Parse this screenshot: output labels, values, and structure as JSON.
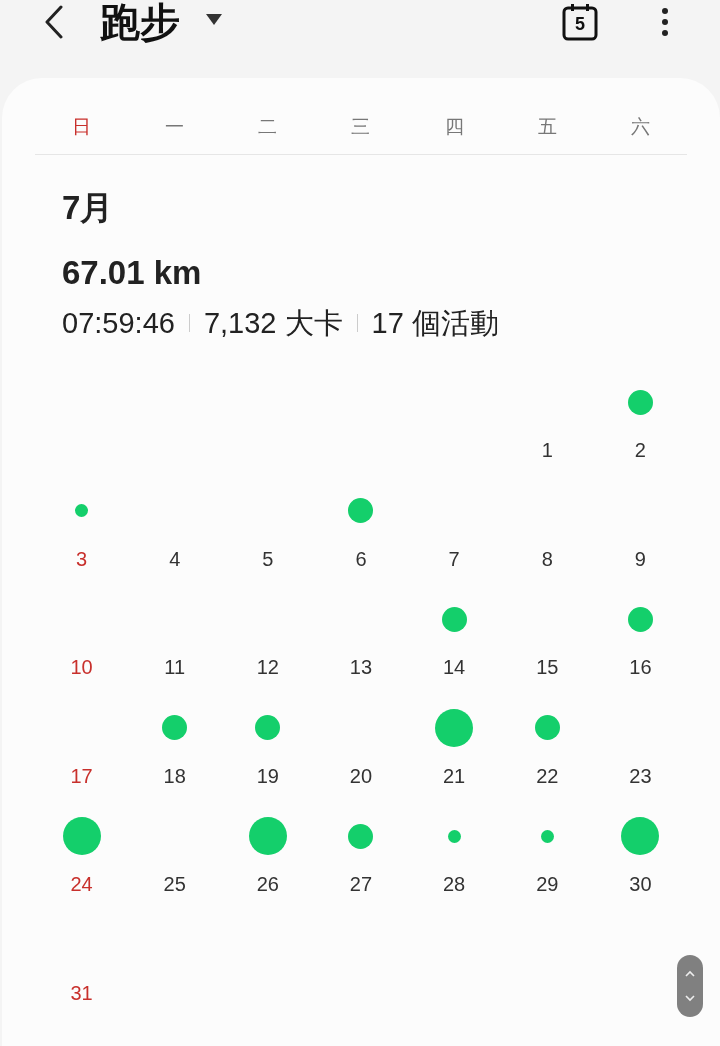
{
  "top_bar": {
    "title": "跑步",
    "calendar_day": "5"
  },
  "weekdays": [
    {
      "label": "日",
      "red": true
    },
    {
      "label": "一",
      "red": false
    },
    {
      "label": "二",
      "red": false
    },
    {
      "label": "三",
      "red": false
    },
    {
      "label": "四",
      "red": false
    },
    {
      "label": "五",
      "red": false
    },
    {
      "label": "六",
      "red": false
    }
  ],
  "summary": {
    "month": "7月",
    "distance": "67.01 km",
    "duration": "07:59:46",
    "calories": "7,132 大卡",
    "activities": "17 個活動"
  },
  "weeks": [
    [
      {
        "day": "1"
      },
      {
        "day": "2",
        "kind": "medium"
      }
    ],
    [
      {
        "day": "3",
        "kind": "small"
      },
      {
        "day": "4"
      },
      {
        "day": "5"
      },
      {
        "day": "6",
        "kind": "medium"
      },
      {
        "day": "7"
      },
      {
        "day": "8"
      },
      {
        "day": "9"
      }
    ],
    [
      {
        "day": "10"
      },
      {
        "day": "11"
      },
      {
        "day": "12"
      },
      {
        "day": "13"
      },
      {
        "day": "14",
        "kind": "medium"
      },
      {
        "day": "15"
      },
      {
        "day": "16",
        "kind": "medium"
      }
    ],
    [
      {
        "day": "17"
      },
      {
        "day": "18",
        "kind": "medium"
      },
      {
        "day": "19",
        "kind": "medium"
      },
      {
        "day": "20"
      },
      {
        "day": "21",
        "kind": "large"
      },
      {
        "day": "22",
        "kind": "medium"
      },
      {
        "day": "23"
      }
    ],
    [
      {
        "day": "24",
        "kind": "large"
      },
      {
        "day": "25"
      },
      {
        "day": "26",
        "kind": "large"
      },
      {
        "day": "27",
        "kind": "medium"
      },
      {
        "day": "28",
        "kind": "small"
      },
      {
        "day": "29",
        "kind": "small"
      },
      {
        "day": "30",
        "kind": "large"
      }
    ],
    [
      {
        "day": "31"
      }
    ]
  ]
}
